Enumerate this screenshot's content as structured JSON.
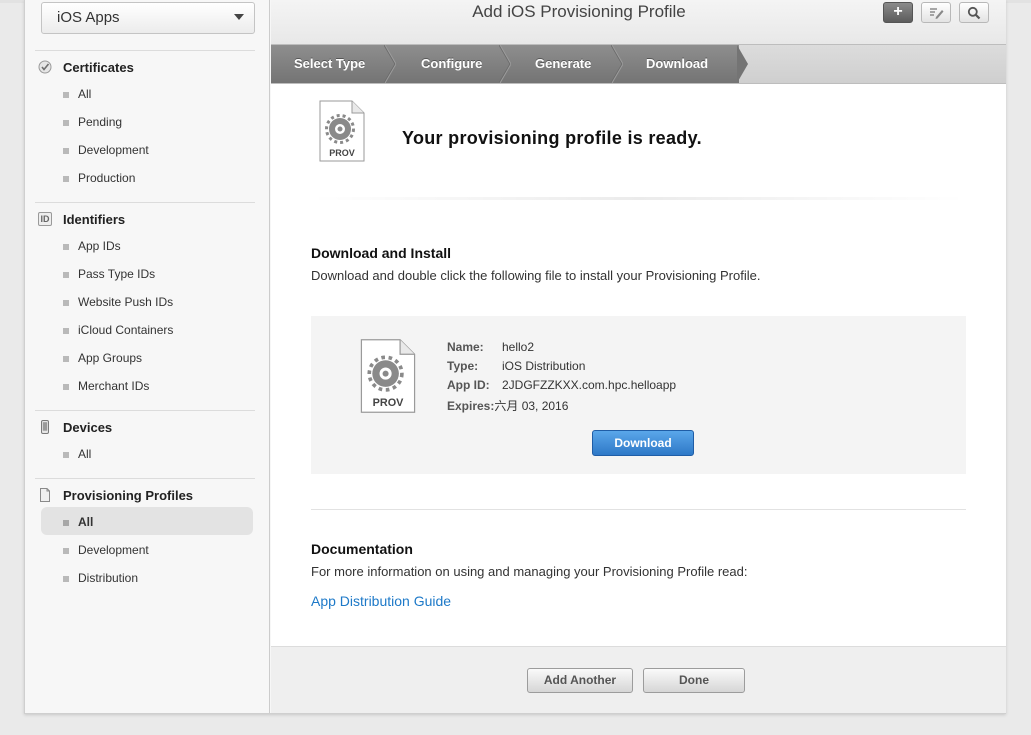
{
  "sidebar": {
    "platform": "iOS Apps",
    "sections": [
      {
        "title": "Certificates",
        "icon": "certificate-icon",
        "items": [
          "All",
          "Pending",
          "Development",
          "Production"
        ]
      },
      {
        "title": "Identifiers",
        "icon": "id-icon",
        "icon_text": "ID",
        "items": [
          "App IDs",
          "Pass Type IDs",
          "Website Push IDs",
          "iCloud Containers",
          "App Groups",
          "Merchant IDs"
        ]
      },
      {
        "title": "Devices",
        "icon": "device-icon",
        "items": [
          "All"
        ]
      },
      {
        "title": "Provisioning Profiles",
        "icon": "profile-document-icon",
        "items": [
          "All",
          "Development",
          "Distribution"
        ],
        "active_item": "All"
      }
    ]
  },
  "header": {
    "title": "Add iOS Provisioning Profile",
    "add_label": "+"
  },
  "steps": [
    "Select Type",
    "Configure",
    "Generate",
    "Download"
  ],
  "ready": {
    "message": "Your provisioning profile is ready.",
    "icon_label": "PROV"
  },
  "download_install": {
    "heading": "Download and Install",
    "description": "Download and double click the following file to install your Provisioning Profile."
  },
  "profile": {
    "icon_label": "PROV",
    "name_label": "Name:",
    "name": "hello2",
    "type_label": "Type:",
    "type": "iOS Distribution",
    "appid_label": "App ID:",
    "app_id": "2JDGFZZKXX.com.hpc.helloapp",
    "expires_label": "Expires:",
    "expires": "六月 03, 2016",
    "download_label": "Download"
  },
  "documentation": {
    "heading": "Documentation",
    "description": "For more information on using and managing your Provisioning Profile read:",
    "link": "App Distribution Guide"
  },
  "footer": {
    "add_another": "Add Another",
    "done": "Done"
  },
  "colors": {
    "link": "#1d79c8",
    "primary_button": "#2e78c7",
    "step_active": "#747474"
  }
}
